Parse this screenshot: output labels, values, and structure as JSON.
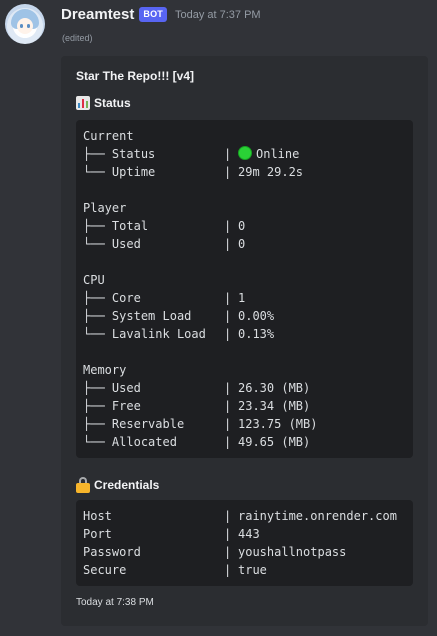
{
  "message": {
    "username": "Dreamtest",
    "bot_tag": "BOT",
    "timestamp": "Today at 7:37 PM",
    "edited": "(edited)"
  },
  "embed": {
    "title": "Star The Repo!!! [v4]",
    "status_field": {
      "name": "Status",
      "icon": "bar-chart-icon",
      "groups": [
        {
          "title": "Current",
          "rows": [
            {
              "branch": "├──",
              "key": "Status",
              "value": "Online",
              "indicator": "green-circle-icon"
            },
            {
              "branch": "└──",
              "key": "Uptime",
              "value": "29m 29.2s"
            }
          ]
        },
        {
          "title": "Player",
          "rows": [
            {
              "branch": "├──",
              "key": "Total",
              "value": "0"
            },
            {
              "branch": "└──",
              "key": "Used",
              "value": "0"
            }
          ]
        },
        {
          "title": "CPU",
          "rows": [
            {
              "branch": "├──",
              "key": "Core",
              "value": "1"
            },
            {
              "branch": "├──",
              "key": "System Load",
              "value": "0.00%"
            },
            {
              "branch": "└──",
              "key": "Lavalink Load",
              "value": "0.13%"
            }
          ]
        },
        {
          "title": "Memory",
          "rows": [
            {
              "branch": "├──",
              "key": "Used",
              "value": "26.30 (MB)"
            },
            {
              "branch": "├──",
              "key": "Free",
              "value": "23.34 (MB)"
            },
            {
              "branch": "├──",
              "key": "Reservable",
              "value": "123.75 (MB)"
            },
            {
              "branch": "└──",
              "key": "Allocated",
              "value": "49.65 (MB)"
            }
          ]
        }
      ]
    },
    "credentials_field": {
      "name": "Credentials",
      "icon": "lock-icon",
      "rows": [
        {
          "key": "Host",
          "value": "rainytime.onrender.com"
        },
        {
          "key": "Port",
          "value": "443"
        },
        {
          "key": "Password",
          "value": "youshallnotpass"
        },
        {
          "key": "Secure",
          "value": "true"
        }
      ]
    },
    "footer": "Today at 7:38 PM"
  },
  "colors": {
    "background": "#313338",
    "embed": "#2b2d31",
    "code_block": "#1e1f22",
    "bot_tag": "#5865f2",
    "online": "#2ad136"
  }
}
